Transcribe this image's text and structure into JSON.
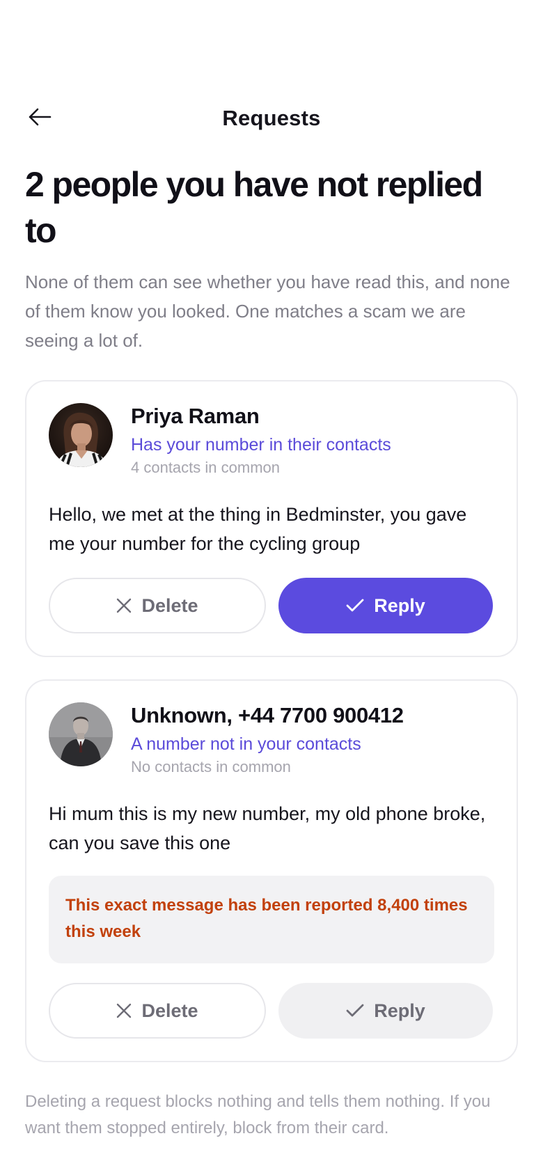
{
  "header": {
    "title": "Requests",
    "back_icon": "arrow-left-icon"
  },
  "headline": "2 people you have not replied to",
  "intro": "None of them can see whether you have read this, and none of them know you looked. One matches a scam we are seeing a lot of.",
  "requests": [
    {
      "name": "Priya Raman",
      "relation": "Has your number in their contacts",
      "common": "4 contacts in common",
      "message": "Hello, we met at the thing in Bedminster, you gave me your number for the cycling group",
      "delete_label": "Delete",
      "reply_label": "Reply"
    },
    {
      "name": "Unknown, +44 7700 900412",
      "relation": "A number not in your contacts",
      "common": "No contacts in common",
      "message": "Hi mum this is my new number, my old phone broke, can you save this one",
      "warning": "This exact message has been reported 8,400 times this week",
      "delete_label": "Delete",
      "reply_label": "Reply"
    }
  ],
  "footnote": "Deleting a request blocks nothing and tells them nothing. If you want them stopped entirely, block from their card.",
  "colors": {
    "accent": "#5b4bdf",
    "relation_text": "#5b4bd9",
    "warning_text": "#c2410c",
    "muted_text": "#7f7e88"
  }
}
